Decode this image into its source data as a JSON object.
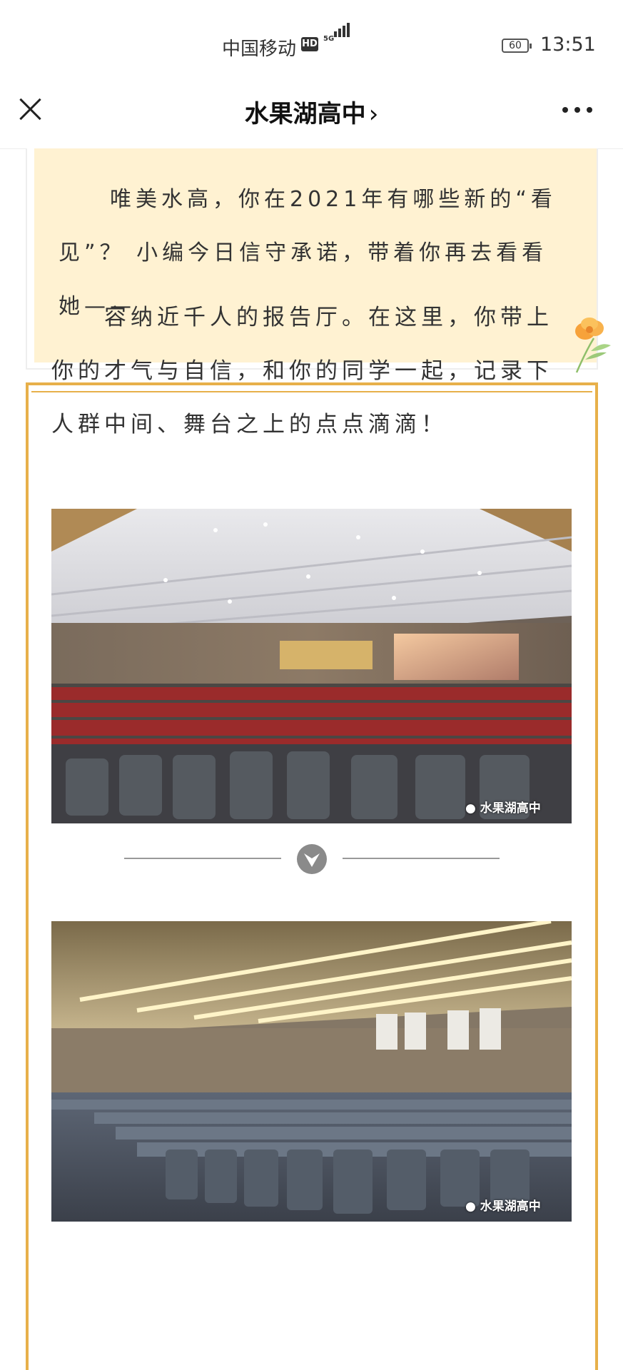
{
  "status_bar": {
    "carrier": "中国移动",
    "hd_badge": "HD",
    "network": "5G",
    "battery": "60",
    "time": "13:51"
  },
  "nav": {
    "title": "水果湖高中",
    "chevron": "›"
  },
  "article": {
    "intro": "唯美水高，你在2021年有哪些新的“看见”？ 小编今日信守承诺，带着你再去看看她——",
    "section_text": "容纳近千人的报告厅。在这里，你带上你的才气与自信，和你的同学一起，记录下人群中间、舞台之上的点点滴滴！",
    "photos": [
      {
        "description": "auditorium photo 1",
        "watermark": "水果湖高中"
      },
      {
        "description": "auditorium photo 2",
        "watermark": "水果湖高中"
      }
    ]
  },
  "colors": {
    "intro_bg": "#fff2d2",
    "frame_border": "#e7b04a"
  }
}
